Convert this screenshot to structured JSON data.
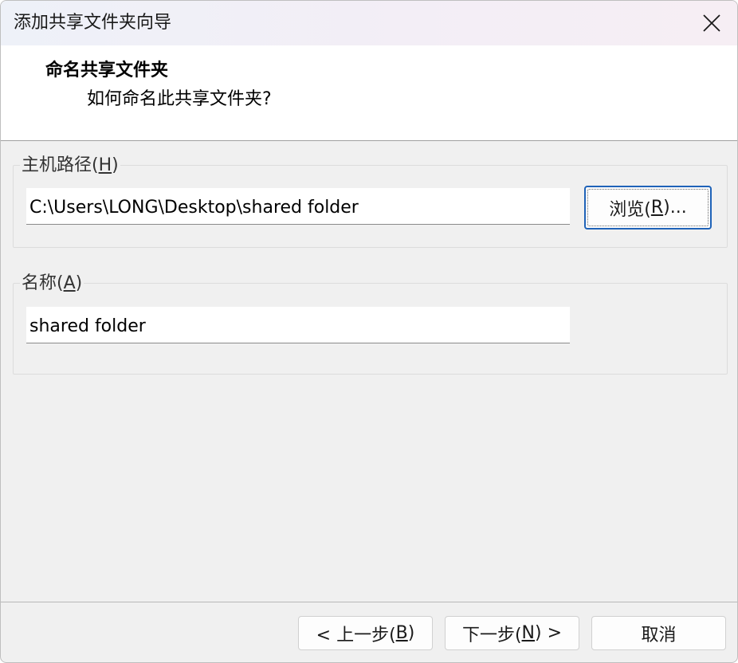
{
  "window": {
    "title": "添加共享文件夹向导"
  },
  "header": {
    "title": "命名共享文件夹",
    "subtitle": "如何命名此共享文件夹?"
  },
  "host_path": {
    "label": "主机路径(",
    "mnemonic": "H",
    "label_end": ")",
    "value": "C:\\Users\\LONG\\Desktop\\shared folder",
    "browse_label": "浏览(",
    "browse_mnemonic": "R",
    "browse_end": ")..."
  },
  "name": {
    "label": "名称(",
    "mnemonic": "A",
    "label_end": ")",
    "value": "shared folder"
  },
  "footer": {
    "back_label": "< 上一步(",
    "back_mnemonic": "B",
    "back_end": ")",
    "next_label": "下一步(",
    "next_mnemonic": "N",
    "next_end": ") >",
    "cancel_label": "取消"
  },
  "colors": {
    "focus_border": "#1f63b8",
    "dialog_background": "#f0f0f0",
    "header_background": "#ffffff"
  },
  "icons": {
    "close": "close-icon"
  }
}
